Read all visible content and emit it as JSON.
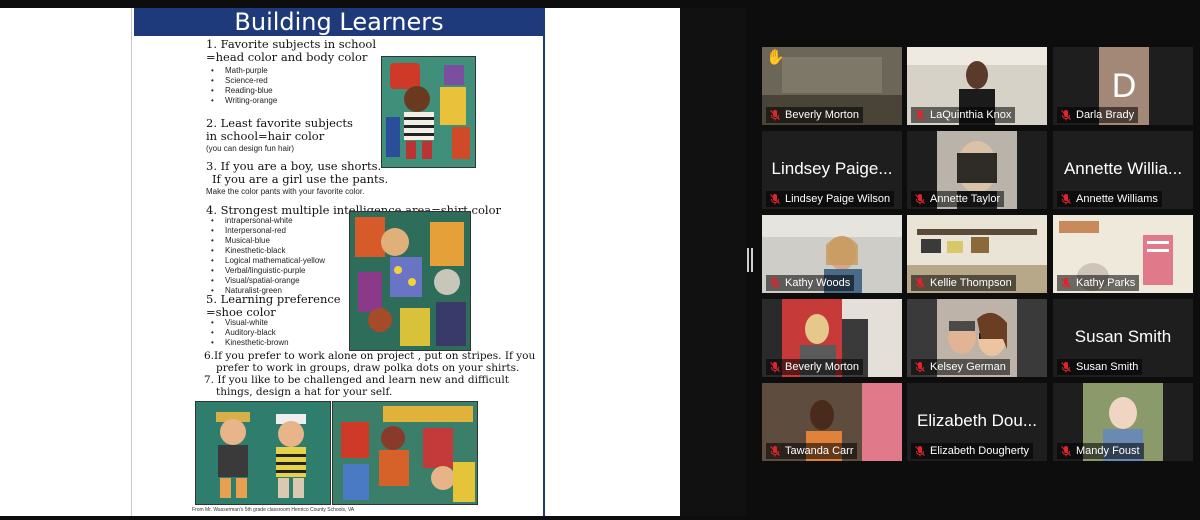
{
  "doc": {
    "title": "Building Learners",
    "item1_line1": "1.   Favorite subjects in school",
    "item1_line2": "=head color and body color",
    "item1_list": [
      "Math-purple",
      "Science-red",
      "Reading-blue",
      "Writing-orange"
    ],
    "item2_line1": "2.  Least favorite subjects",
    "item2_line2": "in school=hair color",
    "item2_note": "(you can design fun hair)",
    "item3_line1": "3. If you are a boy, use shorts.",
    "item3_line2": "If you are a girl use the pants.",
    "item3_note": "Make the color pants with your favorite color.",
    "item4_line1": "4. Strongest multiple intelligence area=shirt color",
    "item4_list": [
      "intrapersonal-white",
      "Interpersonal-red",
      "Musical-blue",
      "Kinesthetic-black",
      "Logical mathematical-yellow",
      "Verbal/linguistic-purple",
      "Visual/spatial-orange",
      "Naturalist-green"
    ],
    "item5_line1": "5.  Learning preference",
    "item5_line2": "=shoe color",
    "item5_list": [
      "Visual-white",
      "Auditory-black",
      "Kinesthetic-brown"
    ],
    "item6_line1": "6.If you prefer to work alone on project , put on stripes.  If you",
    "item6_line2": "prefer to work in groups, draw polka dots  on your shirts.",
    "item7_line1": "7. If you like to be challenged and learn new and difficult",
    "item7_line2": "things, design a hat for your self.",
    "footnote": "From Mr. Wasserman's 5th grade  classroom Henrico County Schools, VA"
  },
  "participants": [
    {
      "name": "Beverly Morton",
      "video": true,
      "raised_hand": true
    },
    {
      "name": "LaQuinthia Knox",
      "video": true
    },
    {
      "name": "Darla Brady",
      "video": false,
      "avatar_letter": "D"
    },
    {
      "name": "Lindsey Paige Wilson",
      "video": false,
      "display": "Lindsey Paige..."
    },
    {
      "name": "Annette Taylor",
      "video": true
    },
    {
      "name": "Annette Williams",
      "video": false,
      "display": "Annette Willia..."
    },
    {
      "name": "Kathy Woods",
      "video": true,
      "active_speaker": true
    },
    {
      "name": "Kellie Thompson",
      "video": true
    },
    {
      "name": "Kathy Parks",
      "video": true
    },
    {
      "name": "Beverly Morton",
      "video": true
    },
    {
      "name": "Kelsey German",
      "video": true
    },
    {
      "name": "Susan Smith",
      "video": false,
      "display": "Susan Smith"
    },
    {
      "name": "Tawanda Carr",
      "video": true
    },
    {
      "name": "Elizabeth Dougherty",
      "video": false,
      "display": "Elizabeth Dou..."
    },
    {
      "name": "Mandy Foust",
      "video": true
    }
  ],
  "colors": {
    "doc_header": "#1f3a7a",
    "active_speaker": "#c8d35a",
    "muted_icon": "#e0242b",
    "tile_bg": "#1e1e1e"
  }
}
